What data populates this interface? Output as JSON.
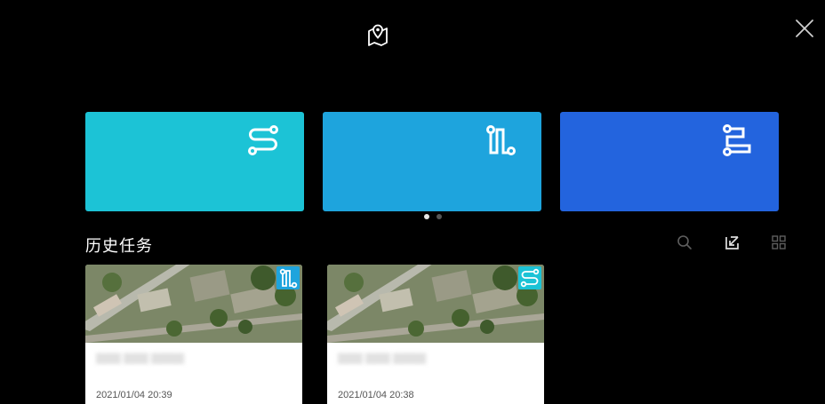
{
  "header": {
    "map_icon": "map-pin-icon",
    "close_icon": "close-icon"
  },
  "mission_types": [
    {
      "name": "waypoint",
      "icon": "waypoint-route-icon",
      "color": "#1cc3d6"
    },
    {
      "name": "area",
      "icon": "area-scan-icon",
      "color": "#1ea4dd"
    },
    {
      "name": "corridor",
      "icon": "corridor-route-icon",
      "color": "#2364de"
    }
  ],
  "pager": {
    "pages": 2,
    "active": 1
  },
  "history": {
    "title": "历史任务",
    "tools": [
      "search-icon",
      "export-icon",
      "grid-view-icon"
    ],
    "items": [
      {
        "time": "2021/01/04 20:39",
        "badge_icon": "area-scan-icon",
        "badge_color": "#1ea4dd"
      },
      {
        "time": "2021/01/04 20:38",
        "badge_icon": "waypoint-route-icon",
        "badge_color": "#1cc3d6"
      }
    ]
  }
}
